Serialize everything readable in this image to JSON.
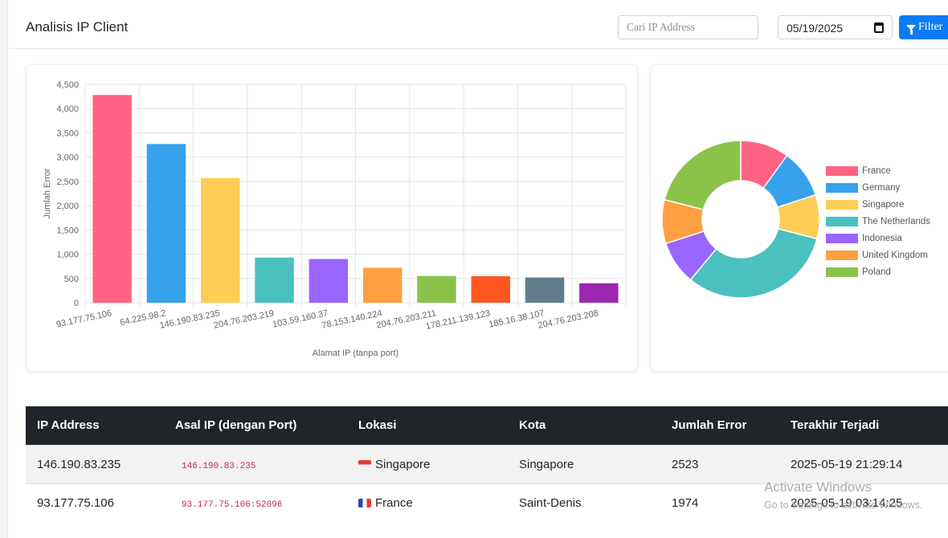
{
  "header": {
    "title": "Analisis IP Client",
    "search_placeholder": "Cari IP Address",
    "date_value": "05/19/2025",
    "filter_label": "Filter"
  },
  "chart_data": [
    {
      "type": "bar",
      "categories": [
        "93.177.75.106",
        "64.225.98.2",
        "146.190.83.235",
        "204.76.203.219",
        "103.59.160.37",
        "78.153.140.224",
        "204.76.203.211",
        "178.211.139.123",
        "185.16.38.107",
        "204.76.203.208"
      ],
      "values": [
        4280,
        3270,
        2570,
        930,
        900,
        720,
        550,
        545,
        520,
        400
      ],
      "colors": [
        "#ff6384",
        "#36a2eb",
        "#ffcd56",
        "#4bc0c0",
        "#9966ff",
        "#ff9f40",
        "#8bc34a",
        "#ff5722",
        "#607d8b",
        "#9c27b0"
      ],
      "xlabel": "Alamat IP (tanpa port)",
      "ylabel": "Jumlah Error",
      "ylim": [
        0,
        4500
      ],
      "yticks": [
        0,
        500,
        1000,
        1500,
        2000,
        2500,
        3000,
        3500,
        4000,
        4500
      ],
      "ytick_labels": [
        "0",
        "500",
        "1,000",
        "1,500",
        "2,000",
        "2,500",
        "3,000",
        "3,500",
        "4,000",
        "4,500"
      ],
      "grid": true
    },
    {
      "type": "pie",
      "categories": [
        "France",
        "Germany",
        "Singapore",
        "The Netherlands",
        "Indonesia",
        "United Kingdom",
        "Poland"
      ],
      "values": [
        10,
        10,
        9,
        32,
        9,
        9,
        21
      ],
      "colors": [
        "#ff6384",
        "#36a2eb",
        "#ffcd56",
        "#4bc0c0",
        "#9966ff",
        "#ff9f40",
        "#8bc34a"
      ],
      "legend": "right"
    }
  ],
  "table": {
    "headers": [
      "IP Address",
      "Asal IP (dengan Port)",
      "Lokasi",
      "Kota",
      "Jumlah Error",
      "Terakhir Terjadi"
    ],
    "rows": [
      {
        "ip": "146.190.83.235",
        "origin": "146.190.83.235",
        "flag": "flag-sg",
        "location": "Singapore",
        "city": "Singapore",
        "errors": "2523",
        "last": "2025-05-19 21:29:14"
      },
      {
        "ip": "93.177.75.106",
        "origin": "93.177.75.106:52096",
        "flag": "flag-fr",
        "location": "France",
        "city": "Saint-Denis",
        "errors": "1974",
        "last": "2025-05-19 03:14:25"
      }
    ]
  },
  "watermark": {
    "title": "Activate Windows",
    "subtitle": "Go to Settings to activate Windows."
  }
}
